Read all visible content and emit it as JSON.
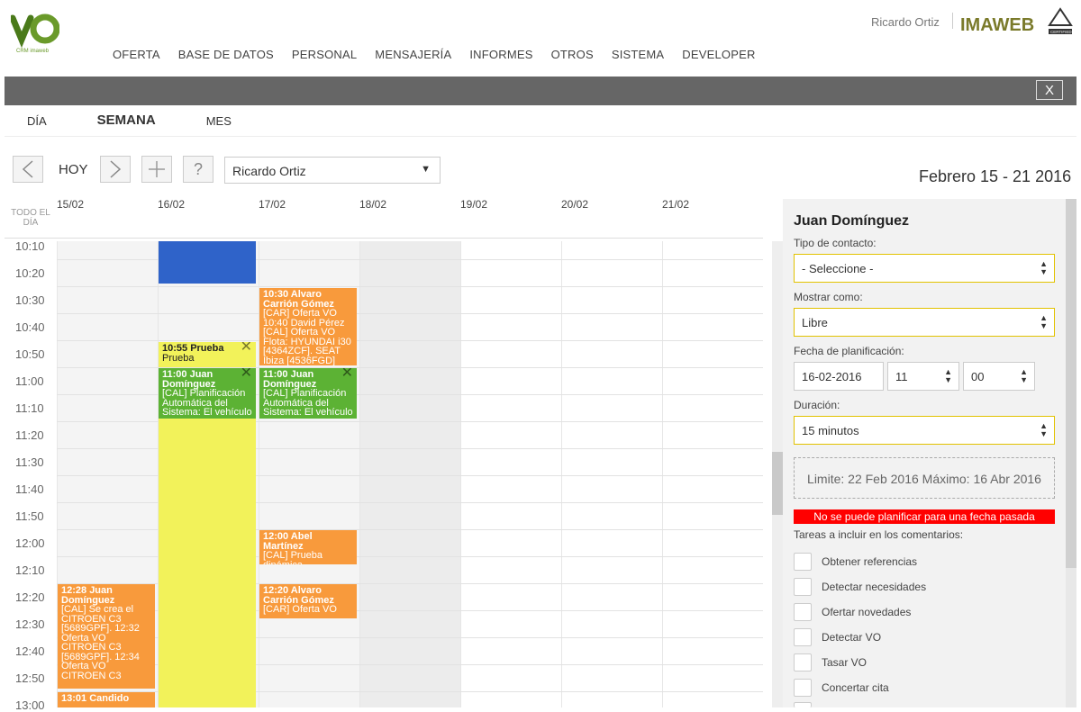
{
  "header": {
    "logo_text": "CRM imaweb",
    "nav": [
      "OFERTA",
      "BASE DE DATOS",
      "PERSONAL",
      "MENSAJERÍA",
      "INFORMES",
      "OTROS",
      "SISTEMA",
      "DEVELOPER"
    ],
    "user": "Ricardo Ortiz",
    "brand": "IMAWEB",
    "cert_text": "CERTIFIED"
  },
  "topbar": {
    "close_label": "X"
  },
  "views": [
    "DÍA",
    "SEMANA",
    "MES"
  ],
  "active_view": "SEMANA",
  "toolbar": {
    "today": "HOY",
    "help": "?",
    "user_select": "Ricardo Ortiz",
    "date_range": "Febrero 15 - 21 2016"
  },
  "calendar": {
    "allday_label": "TODO EL DÍA",
    "days": [
      "15/02",
      "16/02",
      "17/02",
      "18/02",
      "19/02",
      "20/02",
      "21/02"
    ],
    "times": [
      "10:10",
      "10:20",
      "10:30",
      "10:40",
      "10:50",
      "11:00",
      "11:10",
      "11:20",
      "11:30",
      "11:40",
      "11:50",
      "12:00",
      "12:10",
      "12:20",
      "12:30",
      "12:40",
      "12:50",
      "13:00"
    ],
    "events": [
      {
        "text": "",
        "color": "#2f63c9"
      },
      {
        "title": "10:30 Alvaro Carrión Gómez",
        "body": "[CAR] Oferta VO 10:40 David Pérez [CAL] Oferta VO Flota: HYUNDAI i30 [4364ZCF]. SEAT Ibiza [4536FGD]",
        "color": "#f89a3c"
      },
      {
        "title": "10:55 Prueba",
        "body": "Prueba",
        "color": "#f2f25a"
      },
      {
        "title": "11:00 Juan Domínguez",
        "body": "[CAL] Planificación Automática del Sistema: El vehículo",
        "color": "#5cb234"
      },
      {
        "title": "11:00 Juan Domínguez",
        "body": "[CAL] Planificación Automática del Sistema: El vehículo",
        "color": "#5cb234"
      },
      {
        "title": "12:00 Abel Martínez",
        "body": "[CAL] Prueba dinámica",
        "color": "#f89a3c"
      },
      {
        "title": "12:20 Alvaro Carrión Gómez",
        "body": "[CAR] Oferta VO",
        "color": "#f89a3c"
      },
      {
        "title": "12:28 Juan Domínguez",
        "body": "[CAL] Se crea el CITROEN C3 [5689GPF]. 12:32 Oferta VO CITROEN C3 [5689GPF]. 12:34 Oferta VO CITROEN C3",
        "color": "#f89a3c"
      },
      {
        "title": "13:01 Candido",
        "body": "",
        "color": "#f89a3c"
      }
    ]
  },
  "panel": {
    "title": "Juan Domínguez",
    "contact_type_label": "Tipo de contacto:",
    "contact_type_value": "- Seleccione -",
    "show_as_label": "Mostrar como:",
    "show_as_value": "Libre",
    "date_label": "Fecha de planificación:",
    "date_value": "16-02-2016",
    "hour_value": "11",
    "minute_value": "00",
    "duration_label": "Duración:",
    "duration_value": "15 minutos",
    "limit_text": "Limite: 22 Feb 2016 Máximo: 16 Abr 2016",
    "alert_text": "No se puede planificar para una fecha pasada",
    "tasks_label": "Tareas a incluir en los comentarios:",
    "tasks": [
      "Obtener referencias",
      "Detectar necesidades",
      "Ofertar novedades",
      "Detectar VO",
      "Tasar VO",
      "Concertar cita"
    ]
  },
  "colors": {
    "orange": "#f89a3c",
    "green": "#5cb234",
    "yellow": "#f2f25a",
    "blue": "#2f63c9",
    "alert": "#ff0000",
    "accent_border": "#e2c200"
  }
}
